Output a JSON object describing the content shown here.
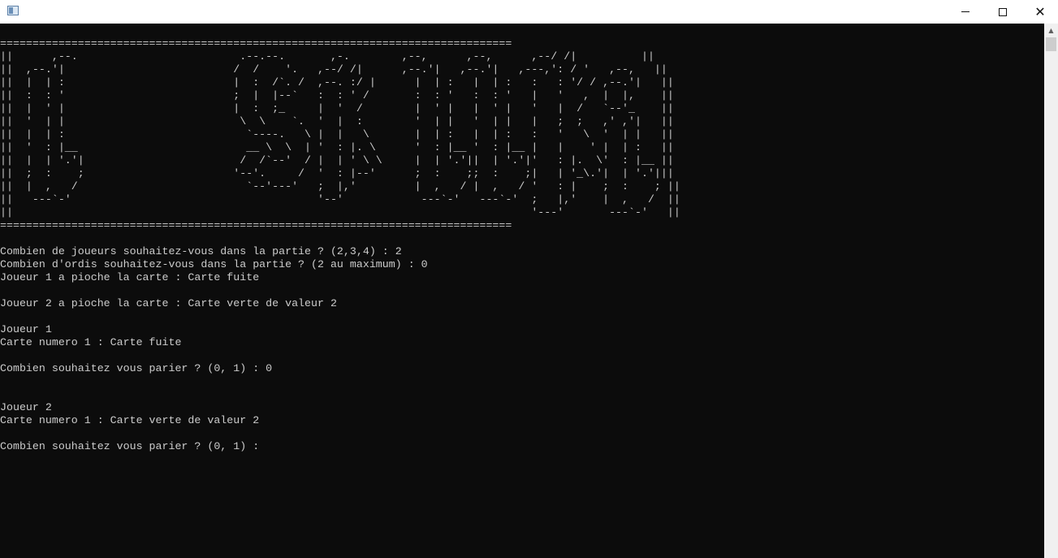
{
  "window": {
    "title": "",
    "controls": {
      "minimize": "—",
      "maximize": "☐",
      "close": "✕"
    },
    "scroll_up_glyph": "▲"
  },
  "console": {
    "lines": [
      "===============================================================================",
      "||      ,--.                         .--.--.       ,-.        ,--,      ,--,      ,--/ /|          ||",
      "||  ,--.'|                          /  /    '.   ,--/ /|      ,--.'|   ,--.'|   ,---,': / '   ,--,   ||",
      "||  |  | :                          |  :  /`. /  ,--. :/ |      |  | :   |  | :   :   : '/ / ,--.'|   ||",
      "||  :  : '                          ;  |  |--`   :  : ' /       :  : '   :  : '   |   '   ,  |  |,    ||",
      "||  |  ' |                          |  :  ;_     |  '  /        |  ' |   |  ' |   '   |  /   `--'_    ||",
      "||  '  | |                           \\  \\    `.  '  |  :        '  | |   '  | |   |   ;  ;   ,' ,'|   ||",
      "||  |  | :                            `----.   \\ |  |   \\       |  | :   |  | :   :   '   \\  '  | |   ||",
      "||  '  : |__                          __ \\  \\  | '  : |. \\      '  : |__ '  : |__ |   |    ' |  | :   ||",
      "||  |  | '.'|                        /  /`--'  / |  | ' \\ \\     |  | '.'||  | '.'|'   : |.  \\'  : |__ ||",
      "||  ;  :    ;                       '--'.     /  '  : |--'      ;  :    ;;  :    ;|   | '_\\.'|  | '.'|||",
      "||  |  ,   /                          `--'---'   ;  |,'         |  ,   / |  ,   / '   : |    ;  :    ; ||",
      "||   ---`-'                                      '--'            ---`-'   ---`-'  ;   |,'    |  ,   /  ||",
      "||                                                                                '---'       ---`-'   ||",
      "===============================================================================",
      "",
      "Combien de joueurs souhaitez-vous dans la partie ? (2,3,4) : 2",
      "Combien d'ordis souhaitez-vous dans la partie ? (2 au maximum) : 0",
      "Joueur 1 a pioche la carte : Carte fuite",
      "",
      "Joueur 2 a pioche la carte : Carte verte de valeur 2",
      "",
      "Joueur 1",
      "Carte numero 1 : Carte fuite",
      "",
      "Combien souhaitez vous parier ? (0, 1) : 0",
      "",
      "",
      "Joueur 2",
      "Carte numero 1 : Carte verte de valeur 2",
      "",
      "Combien souhaitez vous parier ? (0, 1) : "
    ]
  }
}
